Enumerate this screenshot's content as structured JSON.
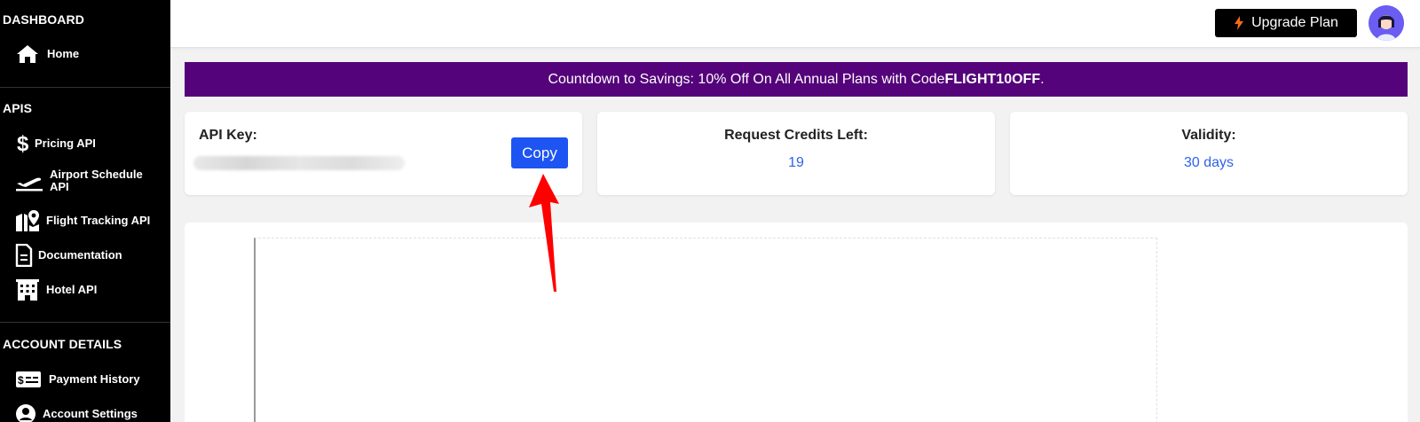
{
  "sidebar": {
    "sections": {
      "dashboard": "DASHBOARD",
      "apis": "APIS",
      "account": "ACCOUNT DETAILS"
    },
    "items": {
      "home": {
        "label": "Home",
        "icon": "home-icon"
      },
      "pricing": {
        "label": "Pricing API",
        "icon": "dollar-icon"
      },
      "airport_line1": {
        "label": "Airport Schedule",
        "icon": "plane-takeoff-icon"
      },
      "airport_line2": {
        "label": "API"
      },
      "tracking": {
        "label": "Flight Tracking API",
        "icon": "map-pin-icon"
      },
      "docs": {
        "label": "Documentation",
        "icon": "document-icon"
      },
      "hotel": {
        "label": "Hotel API",
        "icon": "hotel-icon"
      },
      "payment": {
        "label": "Payment History",
        "icon": "bill-icon"
      },
      "settings": {
        "label": "Account Settings",
        "icon": "user-circle-icon"
      }
    }
  },
  "header": {
    "upgrade_label": "Upgrade Plan",
    "upgrade_icon": "bolt-icon",
    "avatar_icon": "avatar-icon"
  },
  "banner": {
    "text": "Countdown to Savings: 10% Off On All Annual Plans with Code ",
    "code": "FLIGHT10OFF",
    "suffix": ".",
    "color": "#54037a"
  },
  "cards": {
    "api_key": {
      "title": "API Key:",
      "copy_label": "Copy"
    },
    "credits": {
      "title": "Request Credits Left:",
      "value": "19"
    },
    "validity": {
      "title": "Validity:",
      "value": "30 days"
    }
  },
  "colors": {
    "accent": "#1d54f2",
    "value_blue": "#2f62e8",
    "annotation_red": "#ff0000"
  }
}
